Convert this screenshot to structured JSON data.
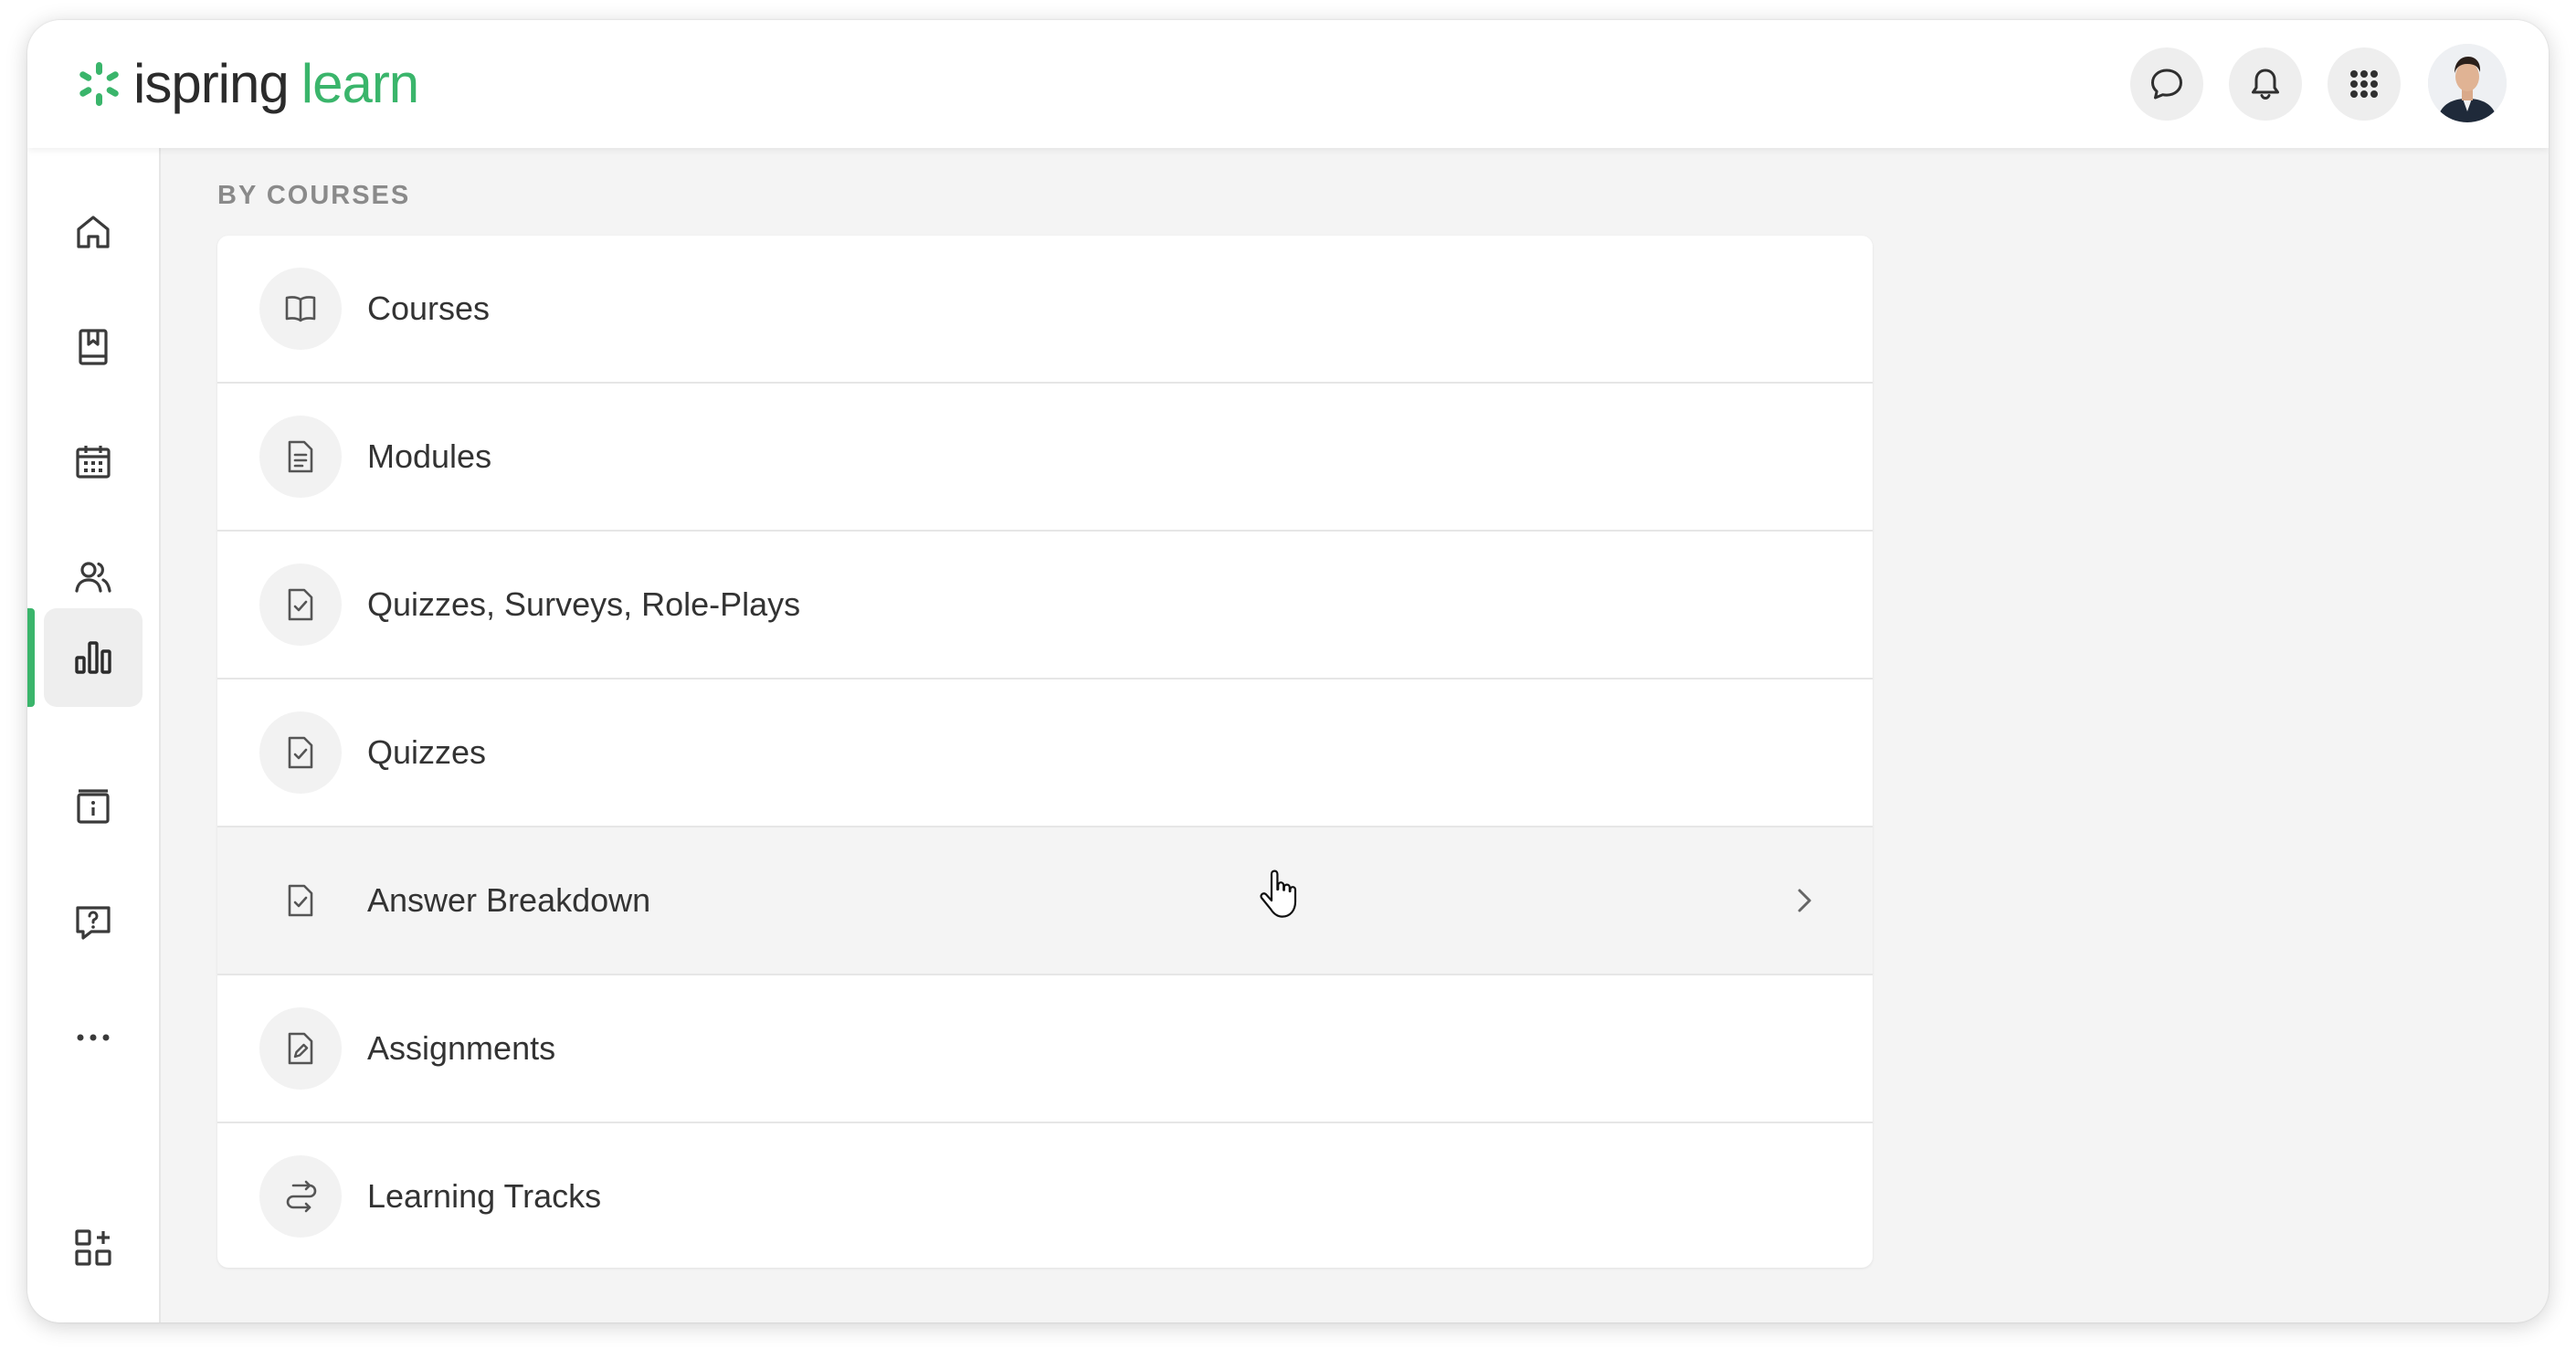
{
  "header": {
    "logo_primary": "ispring",
    "logo_secondary": "learn",
    "actions": [
      {
        "name": "chat-button",
        "icon": "chat-bubble-icon"
      },
      {
        "name": "notifications-button",
        "icon": "bell-icon"
      },
      {
        "name": "apps-button",
        "icon": "grid-icon"
      }
    ],
    "accent_color": "#3ab56b"
  },
  "sidebar": {
    "items": [
      {
        "icon": "home-icon"
      },
      {
        "icon": "book-bookmark-icon"
      },
      {
        "icon": "calendar-icon"
      },
      {
        "icon": "users-icon"
      },
      {
        "icon": "reports-chart-icon",
        "active": true
      },
      {
        "icon": "info-box-icon"
      },
      {
        "icon": "help-chat-icon"
      },
      {
        "icon": "more-icon"
      }
    ],
    "footer_icon": "add-widget-icon"
  },
  "main": {
    "section_title": "BY COURSES",
    "rows": [
      {
        "label": "Courses",
        "icon": "open-book-icon"
      },
      {
        "label": "Modules",
        "icon": "document-icon"
      },
      {
        "label": "Quizzes, Surveys, Role-Plays",
        "icon": "checked-doc-icon"
      },
      {
        "label": "Quizzes",
        "icon": "checked-doc-icon"
      },
      {
        "label": "Answer Breakdown",
        "icon": "checked-doc-icon",
        "hovered": true
      },
      {
        "label": "Assignments",
        "icon": "edit-doc-icon"
      },
      {
        "label": "Learning Tracks",
        "icon": "route-icon"
      }
    ]
  }
}
